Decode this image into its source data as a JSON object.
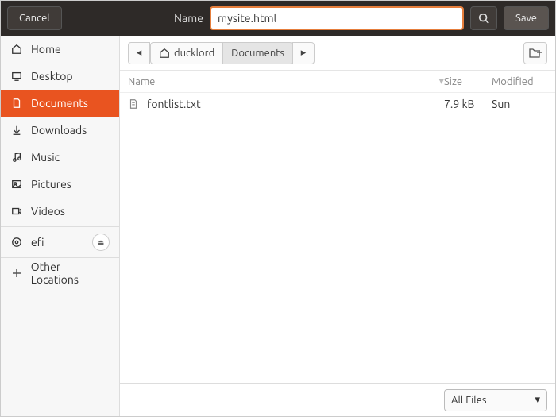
{
  "header": {
    "cancel": "Cancel",
    "name_label": "Name",
    "filename": "mysite.html",
    "save": "Save"
  },
  "sidebar": {
    "items": [
      {
        "label": "Home",
        "icon": "home"
      },
      {
        "label": "Desktop",
        "icon": "desktop"
      },
      {
        "label": "Documents",
        "icon": "documents",
        "active": true
      },
      {
        "label": "Downloads",
        "icon": "downloads"
      },
      {
        "label": "Music",
        "icon": "music"
      },
      {
        "label": "Pictures",
        "icon": "pictures"
      },
      {
        "label": "Videos",
        "icon": "videos"
      }
    ],
    "drives": [
      {
        "label": "efi",
        "icon": "disk",
        "ejectable": true
      }
    ],
    "other": {
      "label": "Other Locations",
      "icon": "plus"
    }
  },
  "path": {
    "segments": [
      {
        "label": "ducklord",
        "icon": "home"
      },
      {
        "label": "Documents",
        "active": true
      }
    ]
  },
  "columns": {
    "name": "Name",
    "size": "Size",
    "modified": "Modified"
  },
  "files": [
    {
      "name": "fontlist.txt",
      "size": "7.9 kB",
      "modified": "Sun"
    }
  ],
  "footer": {
    "filter": "All Files"
  }
}
